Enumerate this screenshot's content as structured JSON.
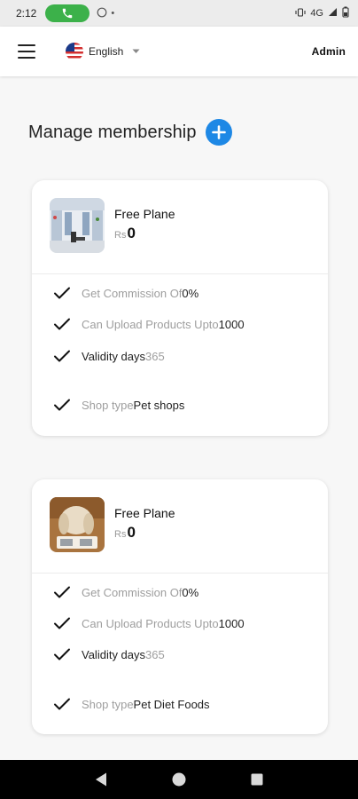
{
  "status_bar": {
    "time": "2:12",
    "network": "4G"
  },
  "app_bar": {
    "language": "English",
    "user": "Admin"
  },
  "page": {
    "title": "Manage membership"
  },
  "plans": [
    {
      "name": "Free Plane",
      "currency": "Rs",
      "price": "0",
      "features": [
        {
          "label": "Get Commission Of",
          "value": " 0%"
        },
        {
          "label": "Can Upload Products Upto",
          "value": " 1000"
        },
        {
          "label": "Validity days",
          "value": "365"
        },
        {
          "label": "Shop type",
          "value": "Pet shops"
        }
      ]
    },
    {
      "name": "Free Plane",
      "currency": "Rs",
      "price": "0",
      "features": [
        {
          "label": "Get Commission Of",
          "value": " 0%"
        },
        {
          "label": "Can Upload Products Upto",
          "value": " 1000"
        },
        {
          "label": "Validity days",
          "value": "365"
        },
        {
          "label": "Shop type",
          "value": "Pet Diet Foods"
        }
      ]
    }
  ],
  "icons": {
    "menu": "hamburger-menu-icon",
    "flag": "us-flag-icon",
    "add": "plus-circle-icon",
    "check": "checkmark-icon",
    "back": "back-triangle-icon",
    "home": "home-circle-icon",
    "recents": "recents-square-icon"
  },
  "colors": {
    "accent": "#1e88e5",
    "call_pill": "#3cb14a"
  }
}
